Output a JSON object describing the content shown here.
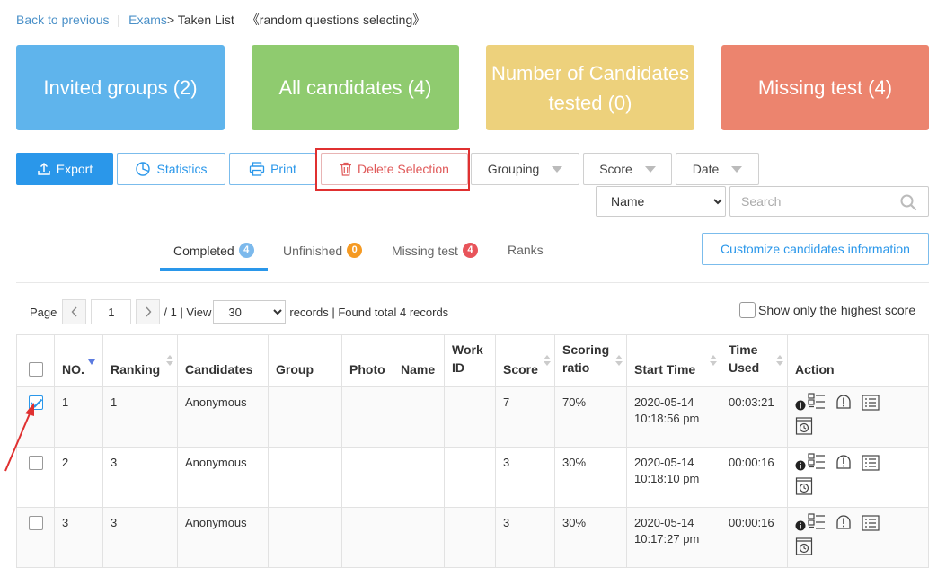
{
  "breadcrumb": {
    "back": "Back to previous",
    "exams": "Exams",
    "current": "> Taken List",
    "exam_name": "《random questions selecting》"
  },
  "cards": {
    "invited": "Invited groups (2)",
    "all": "All candidates (4)",
    "tested": "Number of Candidates tested (0)",
    "missing": "Missing test (4)"
  },
  "toolbar": {
    "export": "Export",
    "statistics": "Statistics",
    "print": "Print",
    "delete": "Delete Selection",
    "grouping": "Grouping",
    "score": "Score",
    "date": "Date"
  },
  "filter": {
    "select_value": "Name",
    "search_placeholder": "Search"
  },
  "tabs": {
    "completed": "Completed",
    "completed_count": "4",
    "unfinished": "Unfinished",
    "unfinished_count": "0",
    "missing": "Missing test",
    "missing_count": "4",
    "ranks": "Ranks"
  },
  "customize": "Customize candidates information",
  "pager": {
    "page_label": "Page",
    "page_value": "1",
    "total_pages": "/ 1 | View",
    "view_value": "30",
    "summary": "records | Found total 4 records",
    "highest": "Show only the highest score"
  },
  "table": {
    "headers": [
      "NO.",
      "Ranking",
      "Candidates",
      "Group",
      "Photo",
      "Name",
      "Work ID",
      "Score",
      "Scoring ratio",
      "Start Time",
      "Time Used",
      "Action"
    ],
    "rows": [
      {
        "checked": true,
        "no": "1",
        "ranking": "1",
        "candidate": "Anonymous",
        "score": "7",
        "ratio": "70%",
        "start_date": "2020-05-14",
        "start_time": "10:18:56 pm",
        "used": "00:03:21"
      },
      {
        "checked": false,
        "no": "2",
        "ranking": "3",
        "candidate": "Anonymous",
        "score": "3",
        "ratio": "30%",
        "start_date": "2020-05-14",
        "start_time": "10:18:10 pm",
        "used": "00:00:16"
      },
      {
        "checked": false,
        "no": "3",
        "ranking": "3",
        "candidate": "Anonymous",
        "score": "3",
        "ratio": "30%",
        "start_date": "2020-05-14",
        "start_time": "10:17:27 pm",
        "used": "00:00:16"
      }
    ]
  },
  "colors": {
    "primary": "#2a97ea",
    "card_blue": "#5fb4ec",
    "card_green": "#8fcb6f",
    "card_yellow": "#edd17c",
    "card_red": "#ec846e",
    "highlight": "#e03030"
  }
}
